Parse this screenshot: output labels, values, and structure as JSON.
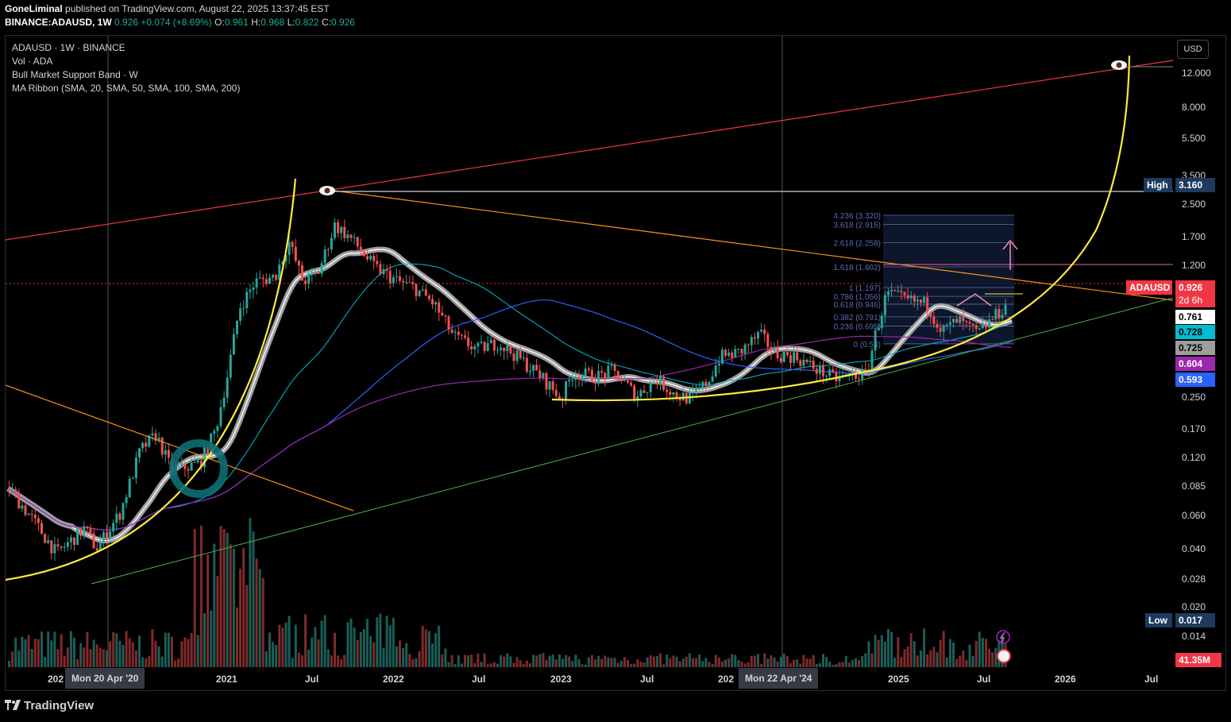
{
  "header": {
    "author": "GoneLiminal",
    "published_text": "published on TradingView.com, August 22, 2025 13:37:45 EST",
    "symbol": "BINANCE:ADAUSD, 1W",
    "last": "0.926",
    "change": "+0.074 (+8.69%)",
    "open_label": "O:",
    "open": "0.961",
    "high_label": "H:",
    "high": "0.968",
    "low_label": "L:",
    "low": "0.822",
    "close_label": "C:",
    "close": "0.926"
  },
  "legend": [
    "ADAUSD · 1W · BINANCE",
    "Vol · ADA",
    "Bull Market Support Band · W",
    "MA Ribbon (SMA, 20, SMA, 50, SMA, 100, SMA, 200)"
  ],
  "currency_button": "USD",
  "chart_data": {
    "type": "candlestick",
    "scale": "log",
    "price_axis_labels": [
      "12.000",
      "8.000",
      "5.500",
      "3.500",
      "2.500",
      "1.700",
      "1.200",
      "0.250",
      "0.170",
      "0.120",
      "0.085",
      "0.060",
      "0.040",
      "0.028",
      "0.020",
      "0.014"
    ],
    "time_axis_labels": [
      "202",
      "2021",
      "Jul",
      "2022",
      "Jul",
      "2023",
      "Jul",
      "202",
      "2025",
      "Jul",
      "2026",
      "Jul"
    ],
    "crosshair_time_labels": [
      "Mon 20 Apr '20",
      "Mon 22 Apr '24"
    ],
    "price_tags": [
      {
        "label": "High",
        "value": "3.160"
      },
      {
        "label": "ADAUSD",
        "value": "0.926",
        "countdown": "2d 6h",
        "color": "#f23645"
      },
      {
        "value": "0.761",
        "color": "#ffffff"
      },
      {
        "value": "0.728",
        "color": "#00bcd4"
      },
      {
        "value": "0.725",
        "color": "#9e9e9e"
      },
      {
        "value": "0.604",
        "color": "#9c27b0"
      },
      {
        "value": "0.593",
        "color": "#2962ff"
      },
      {
        "label": "Low",
        "value": "0.017"
      },
      {
        "value": "41.35M",
        "color": "#f23645"
      }
    ],
    "fib_levels": [
      {
        "ratio": "4.236",
        "price": "3.320"
      },
      {
        "ratio": "3.618",
        "price": "2.915"
      },
      {
        "ratio": "2.618",
        "price": "2.258"
      },
      {
        "ratio": "1.618",
        "price": "1.602"
      },
      {
        "ratio": "1",
        "price": "1.197"
      },
      {
        "ratio": "0.786",
        "price": "1.056"
      },
      {
        "ratio": "0.618",
        "price": "0.946"
      },
      {
        "ratio": "0.382",
        "price": "0.791"
      },
      {
        "ratio": "0.236",
        "price": "0.695"
      },
      {
        "ratio": "0",
        "price": "0.54"
      }
    ],
    "key_points": [
      {
        "time": "2020",
        "price": 0.017
      },
      {
        "time": "2021-09",
        "price": 3.16
      },
      {
        "time": "2022-12",
        "price": 0.24
      },
      {
        "time": "2025-08",
        "price": 0.926
      }
    ],
    "colors": {
      "up": "#26a69a",
      "down": "#ef5350",
      "background": "#000000"
    }
  },
  "brand": "TradingView"
}
